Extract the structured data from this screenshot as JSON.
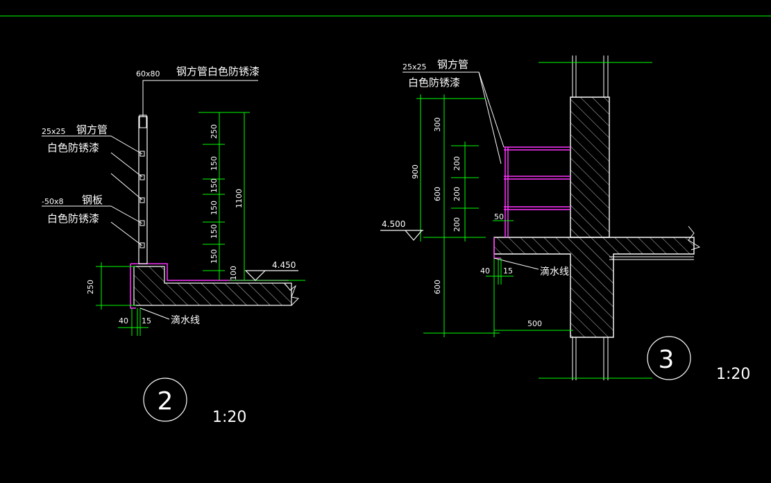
{
  "colors": {
    "background": "#000000",
    "outline": "#ffffff",
    "dimension": "#00ff00",
    "railing": "#ff33ff"
  },
  "detail2": {
    "top_callout": {
      "size": "60x80",
      "text": "钢方管白色防锈漆"
    },
    "callout_a": {
      "size": "25x25",
      "line1": "钢方管",
      "line2": "白色防锈漆"
    },
    "callout_b": {
      "size": "-50x8",
      "line1": "钢板",
      "line2": "白色防锈漆"
    },
    "dims_vertical": [
      "250",
      "150",
      "150",
      "150",
      "150",
      "150",
      "100"
    ],
    "dim_total": "1100",
    "dim_slab": "250",
    "dim_bottom_a": "40",
    "dim_bottom_b": "15",
    "elevation": "4.450",
    "drip_label": "滴水线",
    "number": "2",
    "scale": "1:20"
  },
  "detail3": {
    "callout": {
      "size": "25x25",
      "line1": "钢方管",
      "line2": "白色防锈漆"
    },
    "dims_left": [
      "300",
      "600"
    ],
    "dim_total": "900",
    "dims_inner": [
      "200",
      "200",
      "200"
    ],
    "dim_gap": "50",
    "dim_below": "600",
    "dim_bottom_a": "40",
    "dim_bottom_b": "15",
    "dim_width": "500",
    "elevation": "4.500",
    "drip_label": "滴水线",
    "number": "3",
    "scale": "1:20"
  }
}
